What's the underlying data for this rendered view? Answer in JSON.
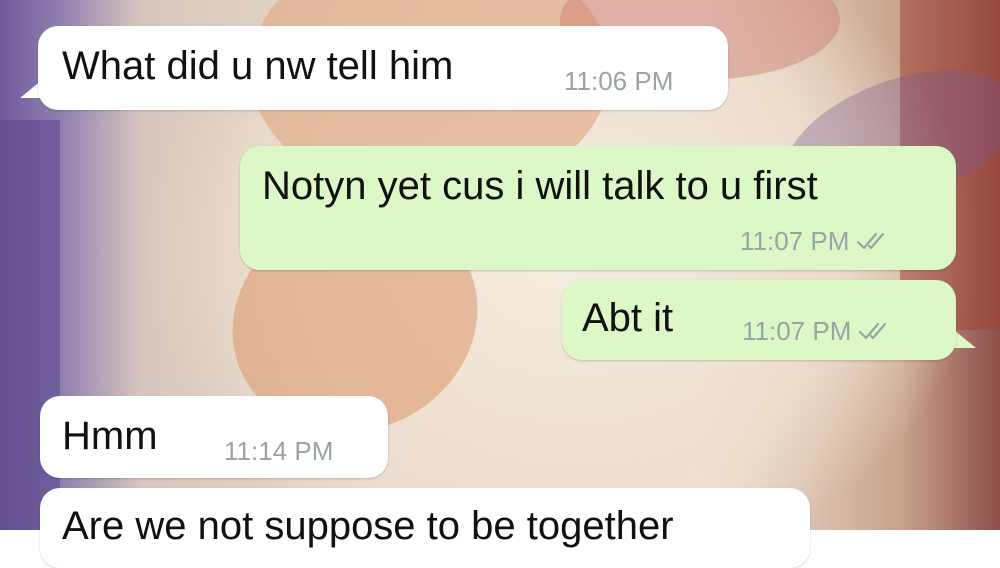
{
  "chat": {
    "messages": [
      {
        "direction": "incoming",
        "text": "What did u nw tell him",
        "time": "11:06 PM"
      },
      {
        "direction": "outgoing",
        "text": "Notyn yet cus i will talk to u first",
        "time": "11:07 PM",
        "status_icon": "double-check-icon"
      },
      {
        "direction": "outgoing",
        "text": "Abt it",
        "time": "11:07 PM",
        "status_icon": "double-check-icon"
      },
      {
        "direction": "incoming",
        "text": "Hmm",
        "time": "11:14 PM"
      },
      {
        "direction": "incoming",
        "text": "Are we not suppose to be together"
      }
    ]
  },
  "colors": {
    "incoming_bubble": "#ffffff",
    "outgoing_bubble": "#dcf8c6",
    "timestamp": "#9aa3a8",
    "message_text": "#111111"
  }
}
